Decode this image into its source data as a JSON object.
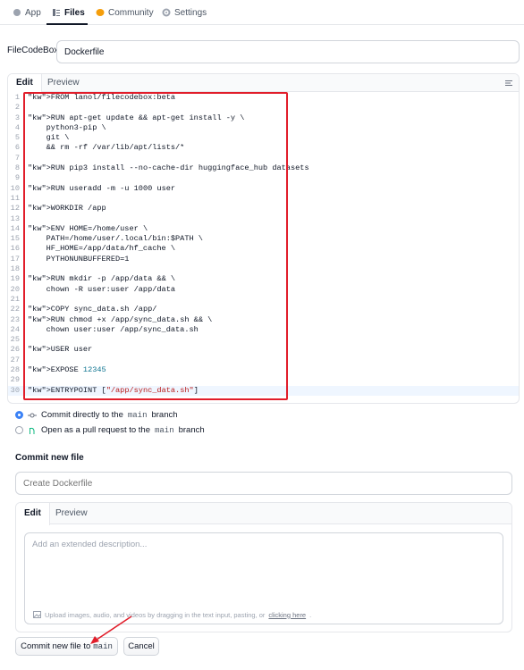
{
  "tabs": [
    {
      "label": "App",
      "icon": "app-icon"
    },
    {
      "label": "Files",
      "icon": "files-icon",
      "active": true
    },
    {
      "label": "Community",
      "icon": "community-icon"
    },
    {
      "label": "Settings",
      "icon": "gear-icon"
    }
  ],
  "path": {
    "prefix": "FileCodeBox/",
    "filename": "Dockerfile"
  },
  "editor": {
    "tabs": [
      "Edit",
      "Preview"
    ],
    "lines": [
      "FROM lanol/filecodebox:beta",
      "",
      "RUN apt-get update && apt-get install -y \\",
      "    python3-pip \\",
      "    git \\",
      "    && rm -rf /var/lib/apt/lists/*",
      "",
      "RUN pip3 install --no-cache-dir huggingface_hub datasets",
      "",
      "RUN useradd -m -u 1000 user",
      "",
      "WORKDIR /app",
      "",
      "ENV HOME=/home/user \\",
      "    PATH=/home/user/.local/bin:$PATH \\",
      "    HF_HOME=/app/data/hf_cache \\",
      "    PYTHONUNBUFFERED=1",
      "",
      "RUN mkdir -p /app/data && \\",
      "    chown -R user:user /app/data",
      "",
      "COPY sync_data.sh /app/",
      "RUN chmod +x /app/sync_data.sh && \\",
      "    chown user:user /app/sync_data.sh",
      "",
      "USER user",
      "",
      "EXPOSE 12345",
      "",
      "ENTRYPOINT [\"/app/sync_data.sh\"]"
    ],
    "current_line": 30,
    "highlight_color": "#e11d2a"
  },
  "commit_options": {
    "direct": {
      "text_before": "Commit directly to the",
      "branch": "main",
      "text_after": "branch"
    },
    "pr": {
      "text_before": "Open as a pull request to the",
      "branch": "main",
      "text_after": "branch"
    }
  },
  "commit": {
    "title": "Commit new file",
    "summary_placeholder": "Create Dockerfile",
    "desc_tabs": [
      "Edit",
      "Preview"
    ],
    "desc_placeholder": "Add an extended description...",
    "hint_text": "Upload images, audio, and videos by dragging in the text input, pasting, or",
    "hint_link": "clicking here",
    "hint_end": "."
  },
  "buttons": {
    "commit_label": "Commit new file to",
    "commit_branch": "main",
    "cancel_label": "Cancel"
  },
  "colors": {
    "accent": "#3b82f6",
    "annotation": "#e11d2a"
  }
}
